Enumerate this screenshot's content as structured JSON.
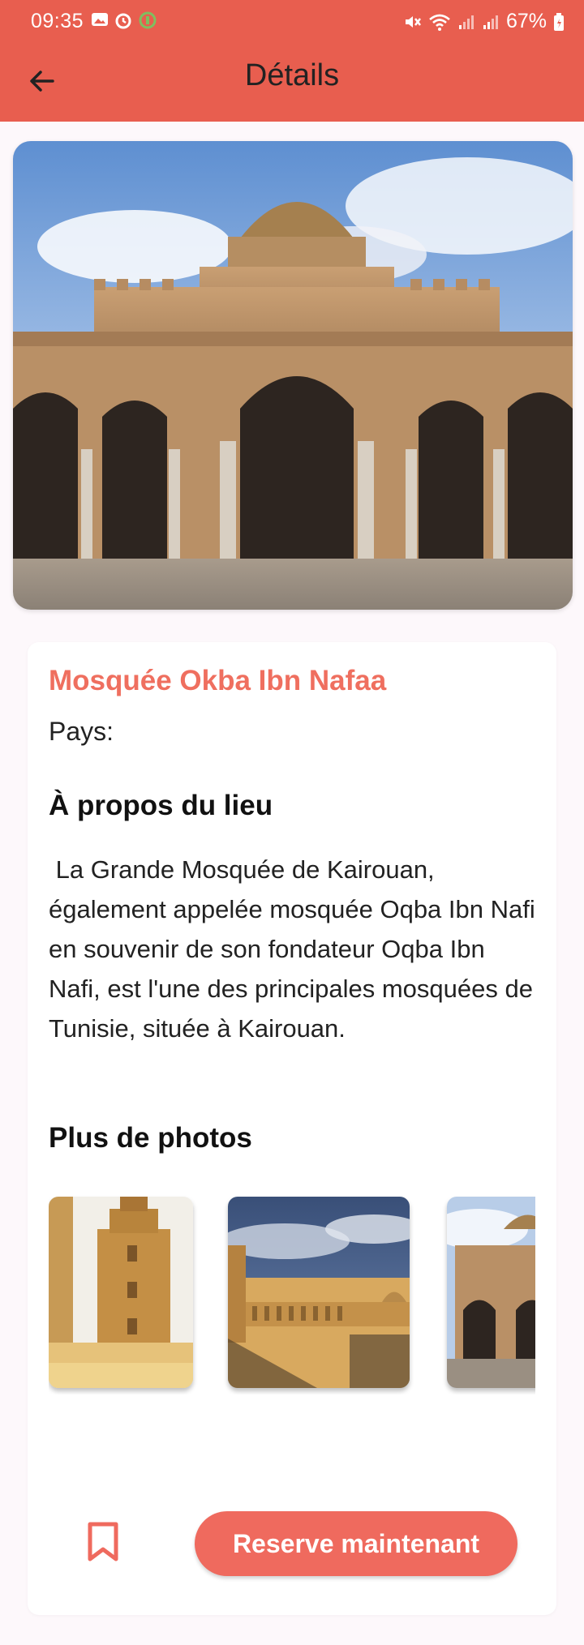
{
  "status_bar": {
    "time": "09:35",
    "battery": "67%",
    "left_icons": [
      "image-icon",
      "alarm-icon",
      "app-notification-icon"
    ],
    "right_icons": [
      "mute-icon",
      "wifi-icon",
      "signal-icon",
      "signal-icon",
      "battery-icon"
    ]
  },
  "appbar": {
    "title": "Détails",
    "back_icon": "arrow-left-icon"
  },
  "hero": {
    "image": "mosque-facade-photo"
  },
  "place": {
    "title": "Mosquée Okba Ibn Nafaa",
    "country_label": "Pays:",
    "about_heading": "À propos du lieu",
    "about_text": " La Grande Mosquée de Kairouan, également appelée mosquée Oqba Ibn Nafi en souvenir de son fondateur Oqba Ibn Nafi, est l'une des principales mosquées de Tunisie, située à Kairouan.",
    "photos_heading": "Plus de photos",
    "photos": [
      "minaret-photo",
      "mosque-aerial-photo",
      "mosque-facade-photo"
    ]
  },
  "actions": {
    "bookmark_icon": "bookmark-icon",
    "reserve_label": "Reserve maintenant"
  },
  "colors": {
    "primary": "#e85e4f",
    "accent_text": "#ef6f5f",
    "button": "#ef6a5e",
    "background": "#fdf8fb"
  }
}
